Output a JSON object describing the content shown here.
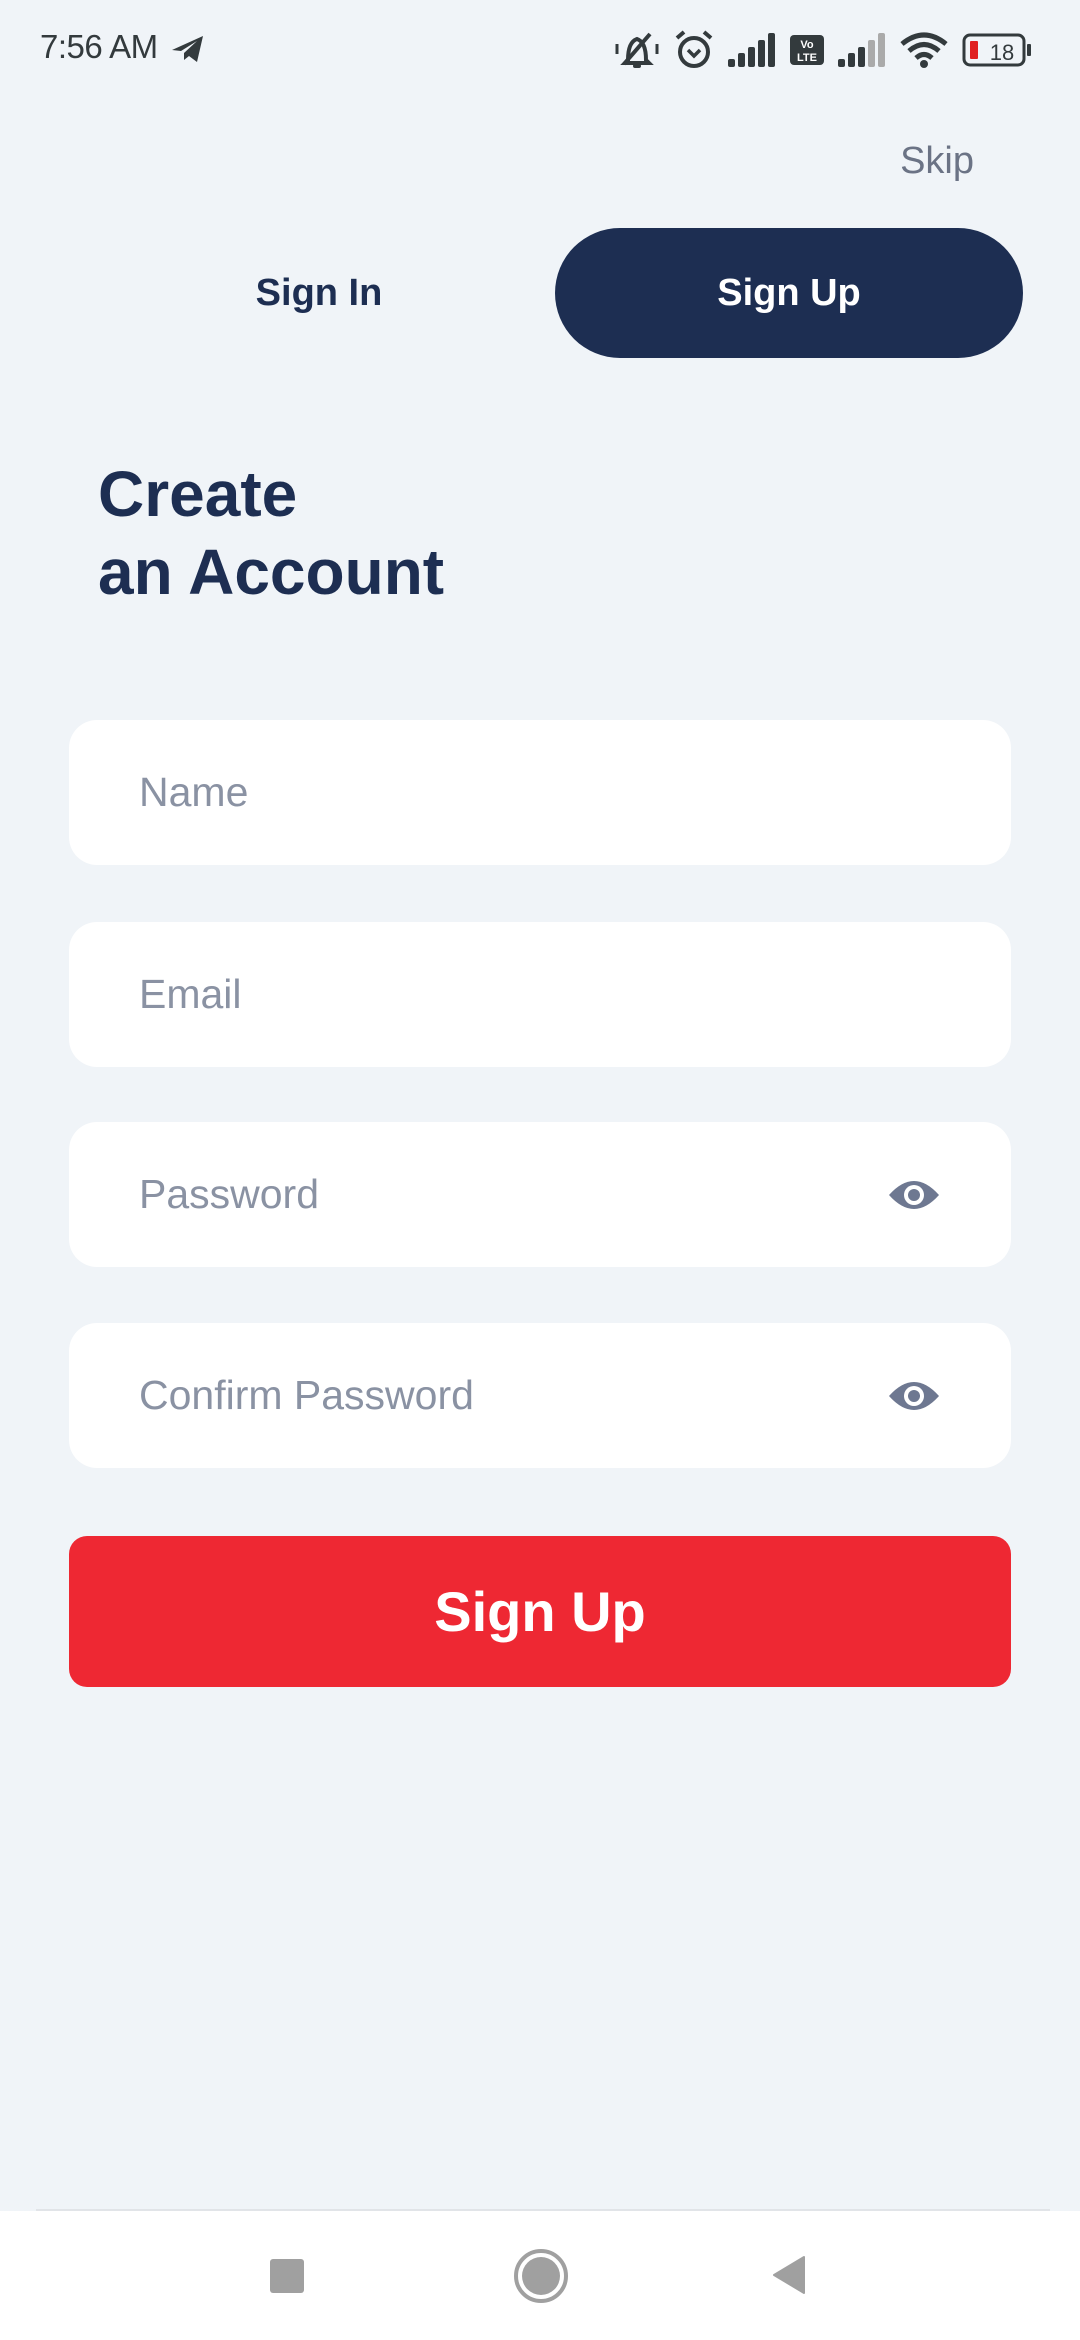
{
  "status_bar": {
    "time": "7:56 AM",
    "battery_level": "18",
    "icons": [
      "telegram-icon",
      "vibrate-mute-icon",
      "alarm-icon",
      "signal-full-icon",
      "volte-icon",
      "signal-partial-icon",
      "wifi-icon",
      "battery-low-icon"
    ],
    "volte_label_top": "Vo",
    "volte_label_bottom": "LTE"
  },
  "header": {
    "skip_label": "Skip"
  },
  "tabs": [
    {
      "label": "Sign In",
      "active": false
    },
    {
      "label": "Sign Up",
      "active": true
    }
  ],
  "title": {
    "line1": "Create",
    "line2": "an Account"
  },
  "form": {
    "fields": [
      {
        "name": "name",
        "placeholder": "Name",
        "value": "",
        "has_visibility_toggle": false
      },
      {
        "name": "email",
        "placeholder": "Email",
        "value": "",
        "has_visibility_toggle": false
      },
      {
        "name": "password",
        "placeholder": "Password",
        "value": "",
        "has_visibility_toggle": true,
        "toggle_icon": "eye-icon"
      },
      {
        "name": "confirm_password",
        "placeholder": "Confirm Password",
        "value": "",
        "has_visibility_toggle": true,
        "toggle_icon": "eye-icon"
      }
    ],
    "submit_label": "Sign Up"
  },
  "nav_bar": {
    "buttons": [
      "recents-icon",
      "home-icon",
      "back-icon"
    ]
  },
  "colors": {
    "background": "#f0f4f8",
    "primary_navy": "#1d2e52",
    "accent_red": "#ee2833",
    "placeholder_gray": "#8a92a3",
    "icon_gray": "#6e7891"
  }
}
